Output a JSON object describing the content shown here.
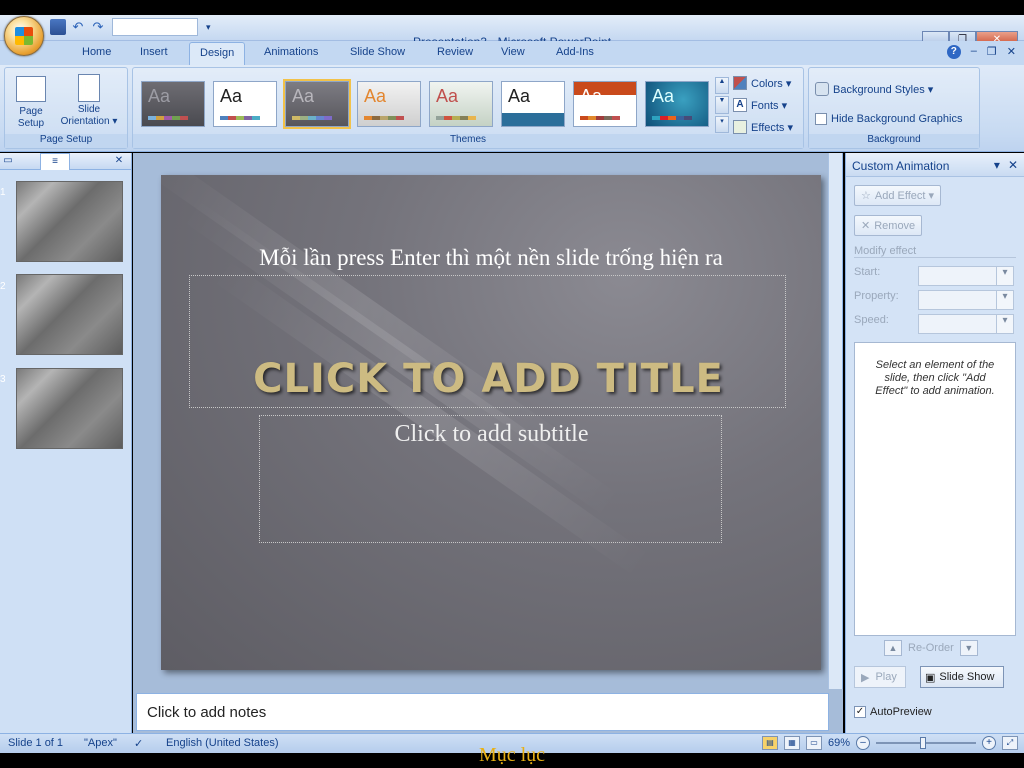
{
  "window": {
    "title": "Presentation3 - Microsoft PowerPoint"
  },
  "ribbon": {
    "tabs": [
      "Home",
      "Insert",
      "Design",
      "Animations",
      "Slide Show",
      "Review",
      "View",
      "Add-Ins"
    ],
    "active_tab": "Design",
    "page_setup": {
      "page_setup_label": "Page\nSetup",
      "slide_orientation_label": "Slide\nOrientation ▾",
      "group_label": "Page Setup"
    },
    "themes": {
      "group_label": "Themes",
      "sample_text": "Aa"
    },
    "theme_options": {
      "colors": "Colors ▾",
      "fonts": "Fonts ▾",
      "effects": "Effects ▾"
    },
    "background": {
      "styles": "Background Styles ▾",
      "hide_graphics": "Hide Background Graphics",
      "group_label": "Background"
    }
  },
  "slides_panel": {
    "slide_numbers": [
      "1",
      "2",
      "3"
    ]
  },
  "slide": {
    "annotation": "Mỗi lần press Enter thì một nền slide trống hiện ra",
    "title_placeholder": "CLICK TO ADD TITLE",
    "subtitle_placeholder": "Click to add subtitle"
  },
  "notes": {
    "placeholder": "Click to add notes"
  },
  "task_pane": {
    "title": "Custom Animation",
    "add_effect": "Add Effect ▾",
    "remove": "Remove",
    "modify_effect": "Modify effect",
    "start_label": "Start:",
    "property_label": "Property:",
    "speed_label": "Speed:",
    "hint": "Select an element of the slide, then click \"Add Effect\" to add animation.",
    "reorder": "Re-Order",
    "play": "Play",
    "slide_show": "Slide Show",
    "autopreview": "AutoPreview"
  },
  "status_bar": {
    "slide_counter": "Slide 1 of 1",
    "theme_name": "\"Apex\"",
    "language": "English (United States)",
    "zoom": "69%"
  },
  "caption": "Mục lục",
  "colors": {
    "ribbon_bg": "#dfeaf8",
    "slide_bg": "#6e6d75",
    "title_gold": "#cdbb82",
    "caption_gold": "#e8b014"
  }
}
